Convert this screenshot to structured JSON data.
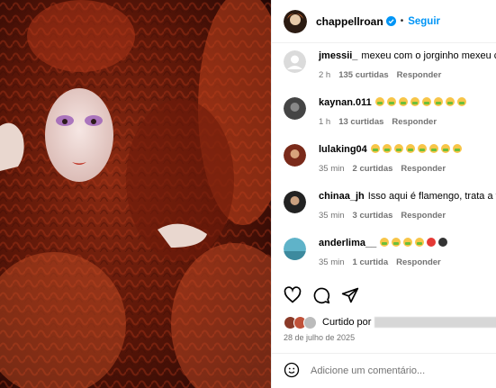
{
  "post": {
    "username": "chappellroan",
    "follow_label": "Seguir",
    "separator": "•"
  },
  "comments": [
    {
      "username": "jmessii_",
      "text": "mexeu com o jorginho mexeu cr",
      "emoji_count": 0,
      "time": "2 h",
      "likes": "135 curtidas",
      "reply": "Responder"
    },
    {
      "username": "kaynan.011",
      "text": "",
      "emoji_count": 8,
      "time": "1 h",
      "likes": "13 curtidas",
      "reply": "Responder"
    },
    {
      "username": "lulaking04",
      "text": "",
      "emoji_count": 8,
      "time": "35 min",
      "likes": "2 curtidas",
      "reply": "Responder"
    },
    {
      "username": "chinaa_jh",
      "text": "Isso aqui é flamengo, trata a fil",
      "emoji_count": 0,
      "time": "35 min",
      "likes": "3 curtidas",
      "reply": "Responder"
    },
    {
      "username": "anderlima__",
      "text": "",
      "emoji_count": 4,
      "time": "35 min",
      "likes": "1 curtida",
      "reply": "Responder"
    }
  ],
  "likes": {
    "text": "Curtido por"
  },
  "date": "28 de julho de 2025",
  "add_comment": {
    "placeholder": "Adicione um comentário..."
  },
  "colors": {
    "accent": "#0095f6",
    "muted": "#737373",
    "verified": "#0095f6"
  },
  "icons": [
    "verified-badge-icon",
    "heart-icon",
    "comment-icon",
    "share-icon",
    "emoji-icon"
  ]
}
